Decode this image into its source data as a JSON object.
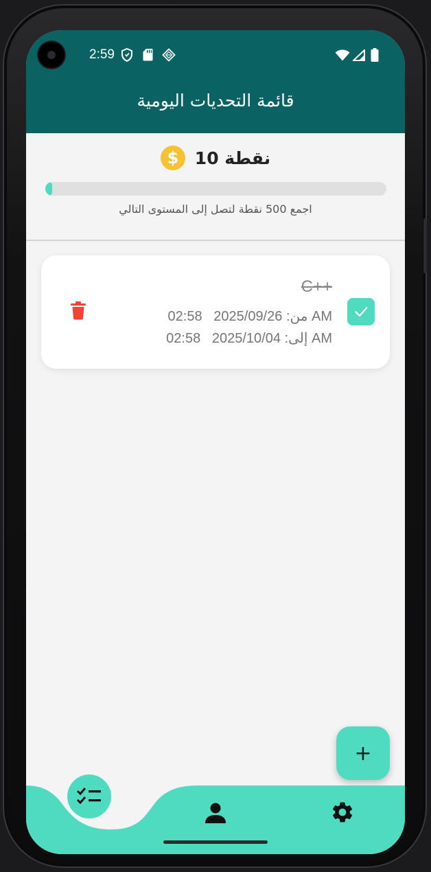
{
  "status_bar": {
    "time": "2:59",
    "icons": [
      "shield-icon",
      "sd-card-icon",
      "vpn-diamond-icon",
      "wifi-icon",
      "signal-icon",
      "battery-icon"
    ]
  },
  "app_bar": {
    "title": "قائمة التحديات اليومية"
  },
  "points": {
    "text": "نقطة 10",
    "coin_symbol": "$",
    "progress_fraction": 0.02,
    "progress_label": "اجمع 500 نقطة لتصل إلى المستوى التالي"
  },
  "tasks": [
    {
      "title": "C++",
      "completed": true,
      "from_ampm": "AM",
      "from_label": "من:",
      "from_date": "2025/09/26",
      "from_time": "02:58",
      "to_ampm": "AM",
      "to_label": "إلى:",
      "to_date": "2025/10/04",
      "to_time": "02:58"
    }
  ],
  "fab": {
    "label": "+"
  },
  "bottom_nav": {
    "items": [
      "tasks-list-icon",
      "profile-icon",
      "settings-gear-icon"
    ],
    "active": "tasks-list-icon"
  },
  "colors": {
    "app_bar": "#0b6262",
    "accent": "#4fdbc0",
    "delete": "#f24336",
    "coin": "#f5c234",
    "background": "#f4f4f4"
  }
}
